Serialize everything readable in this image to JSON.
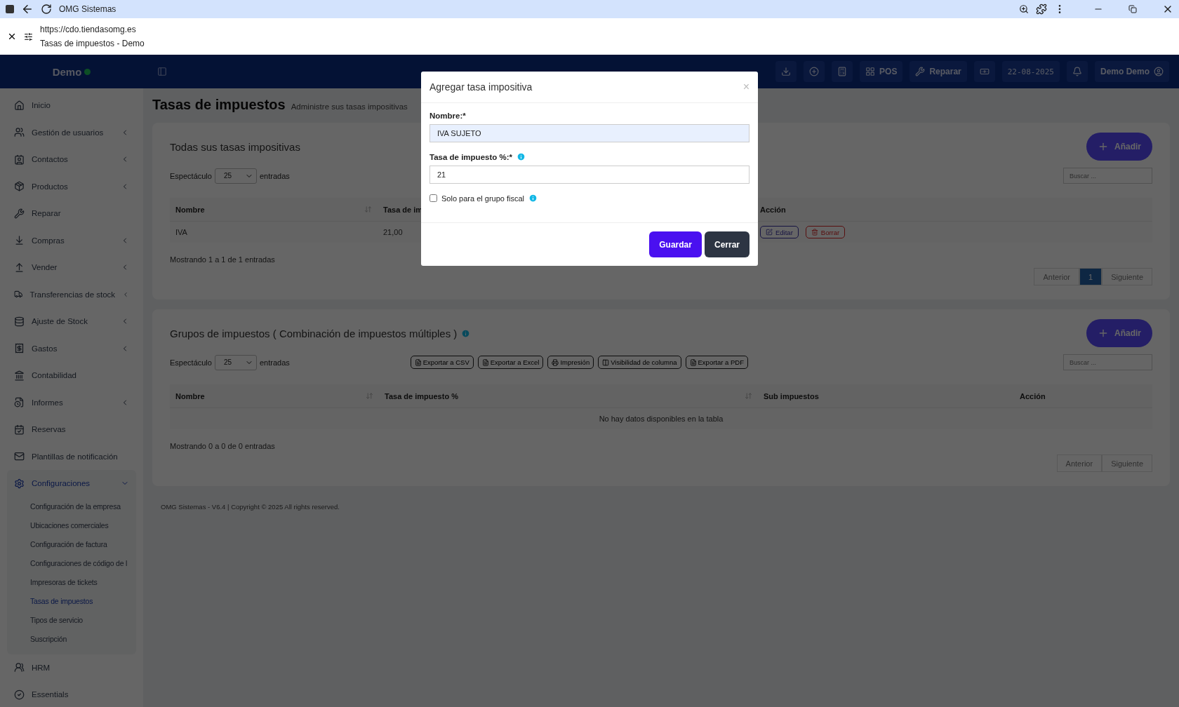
{
  "browser": {
    "title": "OMG Sistemas",
    "url": "https://cdo.tiendasomg.es",
    "page_title": "Tasas de impuestos - Demo"
  },
  "header": {
    "brand": "Demo",
    "online": true,
    "pos_label": "POS",
    "repair_label": "Reparar",
    "date": "22-08-2025",
    "user": "Demo Demo"
  },
  "sidebar": {
    "items": [
      {
        "label": "Inicio",
        "expandable": false
      },
      {
        "label": "Gestión de usuarios",
        "expandable": true
      },
      {
        "label": "Contactos",
        "expandable": true
      },
      {
        "label": "Productos",
        "expandable": true
      },
      {
        "label": "Reparar",
        "expandable": false
      },
      {
        "label": "Compras",
        "expandable": true
      },
      {
        "label": "Vender",
        "expandable": true
      },
      {
        "label": "Transferencias de stock",
        "expandable": true
      },
      {
        "label": "Ajuste de Stock",
        "expandable": true
      },
      {
        "label": "Gastos",
        "expandable": true
      },
      {
        "label": "Contabilidad",
        "expandable": false
      },
      {
        "label": "Informes",
        "expandable": true
      },
      {
        "label": "Reservas",
        "expandable": false
      },
      {
        "label": "Plantillas de notificación",
        "expandable": false
      },
      {
        "label": "Configuraciones",
        "expandable": true,
        "expanded": true,
        "selected": true,
        "children": [
          {
            "label": "Configuración de la empresa",
            "selected": false
          },
          {
            "label": "Ubicaciones comerciales",
            "selected": false
          },
          {
            "label": "Configuración de factura",
            "selected": false
          },
          {
            "label": "Configuraciones de código de l",
            "selected": false
          },
          {
            "label": "Impresoras de tickets",
            "selected": false
          },
          {
            "label": "Tasas de impuestos",
            "selected": true
          },
          {
            "label": "Tipos de servicio",
            "selected": false
          },
          {
            "label": "Suscripción",
            "selected": false
          }
        ]
      },
      {
        "label": "HRM",
        "expandable": false
      },
      {
        "label": "Essentials",
        "expandable": false
      }
    ]
  },
  "page": {
    "title": "Tasas de impuestos",
    "subtitle": "Administre sus tasas impositivas"
  },
  "tax_rates": {
    "title": "Todas sus tasas impositivas",
    "add_button": "Añadir",
    "show_label": "Espectáculo",
    "page_size": "25",
    "entries_label": "entradas",
    "search_placeholder": "Buscar ...",
    "columns": [
      {
        "label": "Nombre",
        "sortable": true
      },
      {
        "label": "Tasa de im",
        "sortable": false
      },
      {
        "label": "Acción",
        "sortable": false
      }
    ],
    "rows": [
      {
        "cells": [
          "IVA",
          "21,00"
        ],
        "edit": "Editar",
        "delete": "Borrar"
      }
    ],
    "info": "Mostrando 1 a 1 de 1 entradas",
    "pagination": {
      "previous": "Anterior",
      "pages": [
        {
          "label": "1",
          "selected": true
        }
      ],
      "next": "Siguiente"
    }
  },
  "tax_groups": {
    "title": "Grupos de impuestos ( Combinación de impuestos múltiples )",
    "add_button": "Añadir",
    "show_label": "Espectáculo",
    "page_size": "25",
    "entries_label": "entradas",
    "search_placeholder": "Buscar ...",
    "exports": [
      "Exportar a CSV",
      "Exportar a Excel",
      "Impresión",
      "Visibilidad de columna",
      "Exportar a PDF"
    ],
    "columns": [
      {
        "label": "Nombre",
        "sortable": true
      },
      {
        "label": "Tasa de impuesto %",
        "sortable": true
      },
      {
        "label": "Sub impuestos",
        "sortable": false
      },
      {
        "label": "Acción",
        "sortable": false
      }
    ],
    "empty": "No hay datos disponibles en la tabla",
    "info": "Mostrando 0 a 0 de 0 entradas",
    "pagination": {
      "previous": "Anterior",
      "next": "Siguiente"
    }
  },
  "footer": "OMG Sistemas - V6.4 | Copyright © 2025 All rights reserved.",
  "modal": {
    "title": "Agregar tasa impositiva",
    "close": "×",
    "fields": [
      {
        "label": "Nombre:*",
        "value": "IVA SUJETO",
        "focused": true,
        "info": false
      },
      {
        "label": "Tasa de impuesto %:*",
        "value": "21",
        "focused": false,
        "info": true
      }
    ],
    "checkbox": {
      "label": "Solo para el grupo fiscal",
      "checked": false,
      "info": true
    },
    "buttons": [
      {
        "label": "Guardar",
        "kind": "primary"
      },
      {
        "label": "Cerrar",
        "kind": "dark"
      }
    ]
  }
}
